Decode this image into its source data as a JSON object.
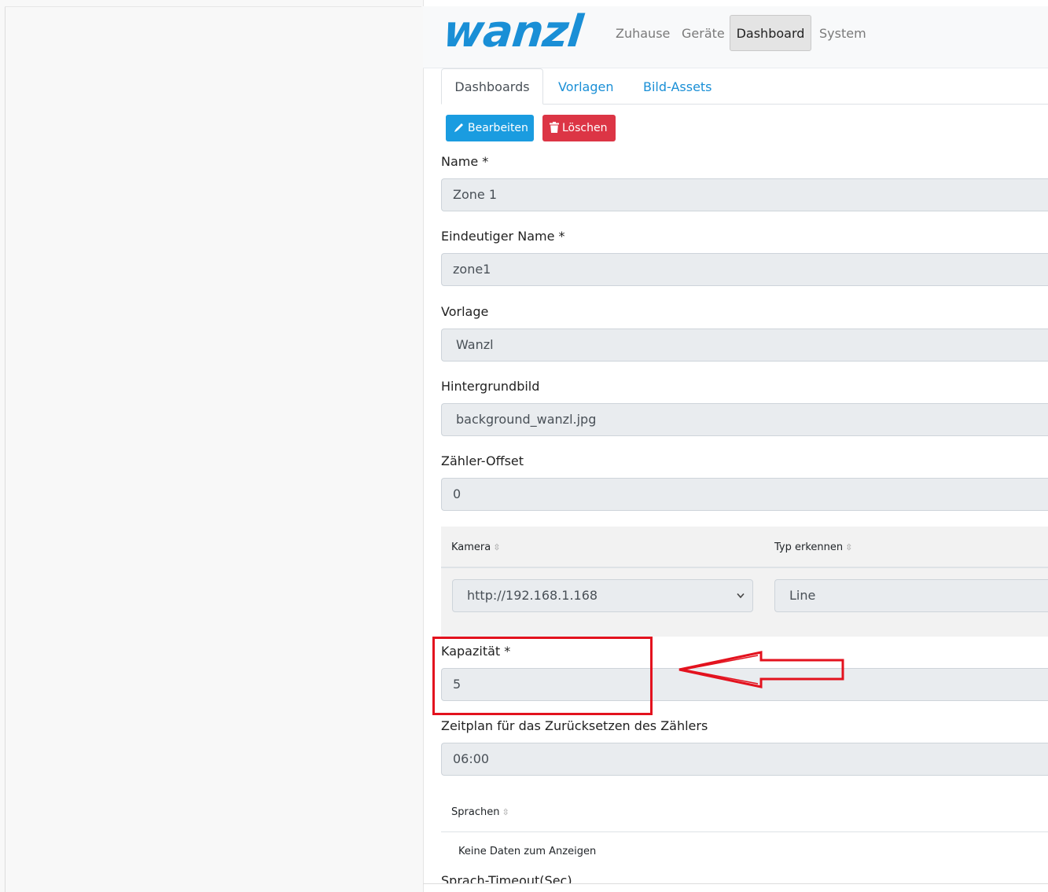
{
  "navbar": {
    "logo_text": "wanzl",
    "links": [
      "Zuhause",
      "Geräte",
      "Dashboard",
      "System"
    ],
    "active": "Dashboard"
  },
  "tabs": {
    "items": [
      "Dashboards",
      "Vorlagen",
      "Bild-Assets"
    ],
    "active": "Dashboards"
  },
  "actions": {
    "edit_label": "Bearbeiten",
    "delete_label": "Löschen",
    "edit_icon": "pencil-icon",
    "delete_icon": "trash-icon"
  },
  "form": {
    "name": {
      "label": "Name *",
      "value": "Zone 1"
    },
    "unique_name": {
      "label": "Eindeutiger Name *",
      "value": "zone1"
    },
    "template": {
      "label": "Vorlage",
      "value": "Wanzl"
    },
    "background": {
      "label": "Hintergrundbild",
      "value": "background_wanzl.jpg"
    },
    "counter_offset": {
      "label": "Zähler-Offset",
      "value": "0"
    },
    "camera_table": {
      "columns": [
        "Kamera",
        "Typ erkennen"
      ],
      "row": {
        "camera": "http://192.168.1.168",
        "type": "Line"
      }
    },
    "capacity": {
      "label": "Kapazität *",
      "value": "5"
    },
    "reset_schedule": {
      "label": "Zeitplan für das Zurücksetzen des Zählers",
      "value": "06:00"
    },
    "languages_table": {
      "columns": [
        "Sprachen"
      ],
      "empty_text": "Keine Daten zum Anzeigen"
    },
    "speech_timeout": {
      "label": "Sprach-Timeout(Sec)"
    }
  },
  "annotation": {
    "highlight_color": "#e3121e"
  },
  "colors": {
    "brand": "#1a8fd6",
    "edit_button": "#1a9ce0",
    "delete_button": "#dc3545"
  }
}
